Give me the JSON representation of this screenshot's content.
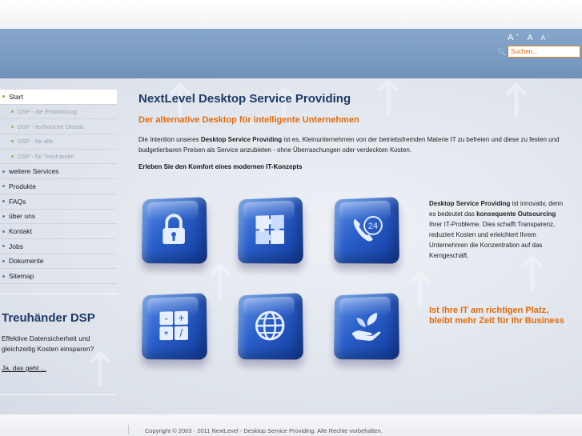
{
  "header": {
    "font_size_controls": [
      "A",
      "A",
      "A"
    ],
    "search": {
      "placeholder": "Suchen..."
    }
  },
  "sidebar": {
    "items": [
      {
        "label": "Start"
      },
      {
        "label": "DSP - die Entwicklung"
      },
      {
        "label": "DSP - technische Details"
      },
      {
        "label": "DSP - für alle"
      },
      {
        "label": "DSP - für Treuhänder"
      },
      {
        "label": "weitere Services"
      },
      {
        "label": "Produkte"
      },
      {
        "label": "FAQs"
      },
      {
        "label": "über uns"
      },
      {
        "label": "Kontakt"
      },
      {
        "label": "Jobs"
      },
      {
        "label": "Dokumente"
      },
      {
        "label": "Sitemap"
      }
    ],
    "promo": {
      "title": "Treuhänder DSP",
      "text": "Effektive Datensicherheit und gleichzeitig Kosten einsparen?",
      "link": "Ja, das geht  ..."
    }
  },
  "main": {
    "title": "NextLevel Desktop Service Providing",
    "subtitle": "Der alternative Desktop für intelligente Unternehmen",
    "intro": {
      "before": "Die Intention unseres ",
      "bold": "Desktop Service Providing",
      "after": " ist es, Kleinunternehmen von der betriebsfremden Materie IT zu befreien und diese zu festen und budgetierbaren Preisen als Service anzubieten - ohne Überraschungen oder verdeckten Kosten."
    },
    "cta_heading": "Erleben Sie den Komfort eines modernen IT-Konzepts",
    "tiles": [
      {
        "icon": "lock-icon"
      },
      {
        "icon": "puzzle-icon"
      },
      {
        "icon": "phone-24-icon",
        "badge": "24"
      },
      {
        "icon": "calculator-icon",
        "symbols": [
          "-",
          "+",
          "*",
          "/"
        ]
      },
      {
        "icon": "globe-icon"
      },
      {
        "icon": "hand-leaf-icon"
      }
    ],
    "side_description": {
      "bold1": "Desktop Service Providing",
      "text1": " ist innovativ, denn es bedeutet das ",
      "bold2": "konsequente Outsourcing",
      "text2": " Ihrer IT-Probleme. Dies schafft Transparenz, reduziert Kosten und erleichtert Ihrem Unternehmen die Konzentration auf das Kerngeschäft."
    },
    "side_question": "Ist Ihre IT am richtigen Platz, bleibt mehr Zeit für Ihr Business"
  },
  "footer": {
    "copyright": "Copyright © 2003 - 2011 NextLevel - Desktop Service Providing. Alle Rechte vorbehalten."
  },
  "colors": {
    "accent": "#e36c09",
    "title": "#1e3a66",
    "header": "#7a9bc0",
    "cube": "#2a5fc9"
  }
}
